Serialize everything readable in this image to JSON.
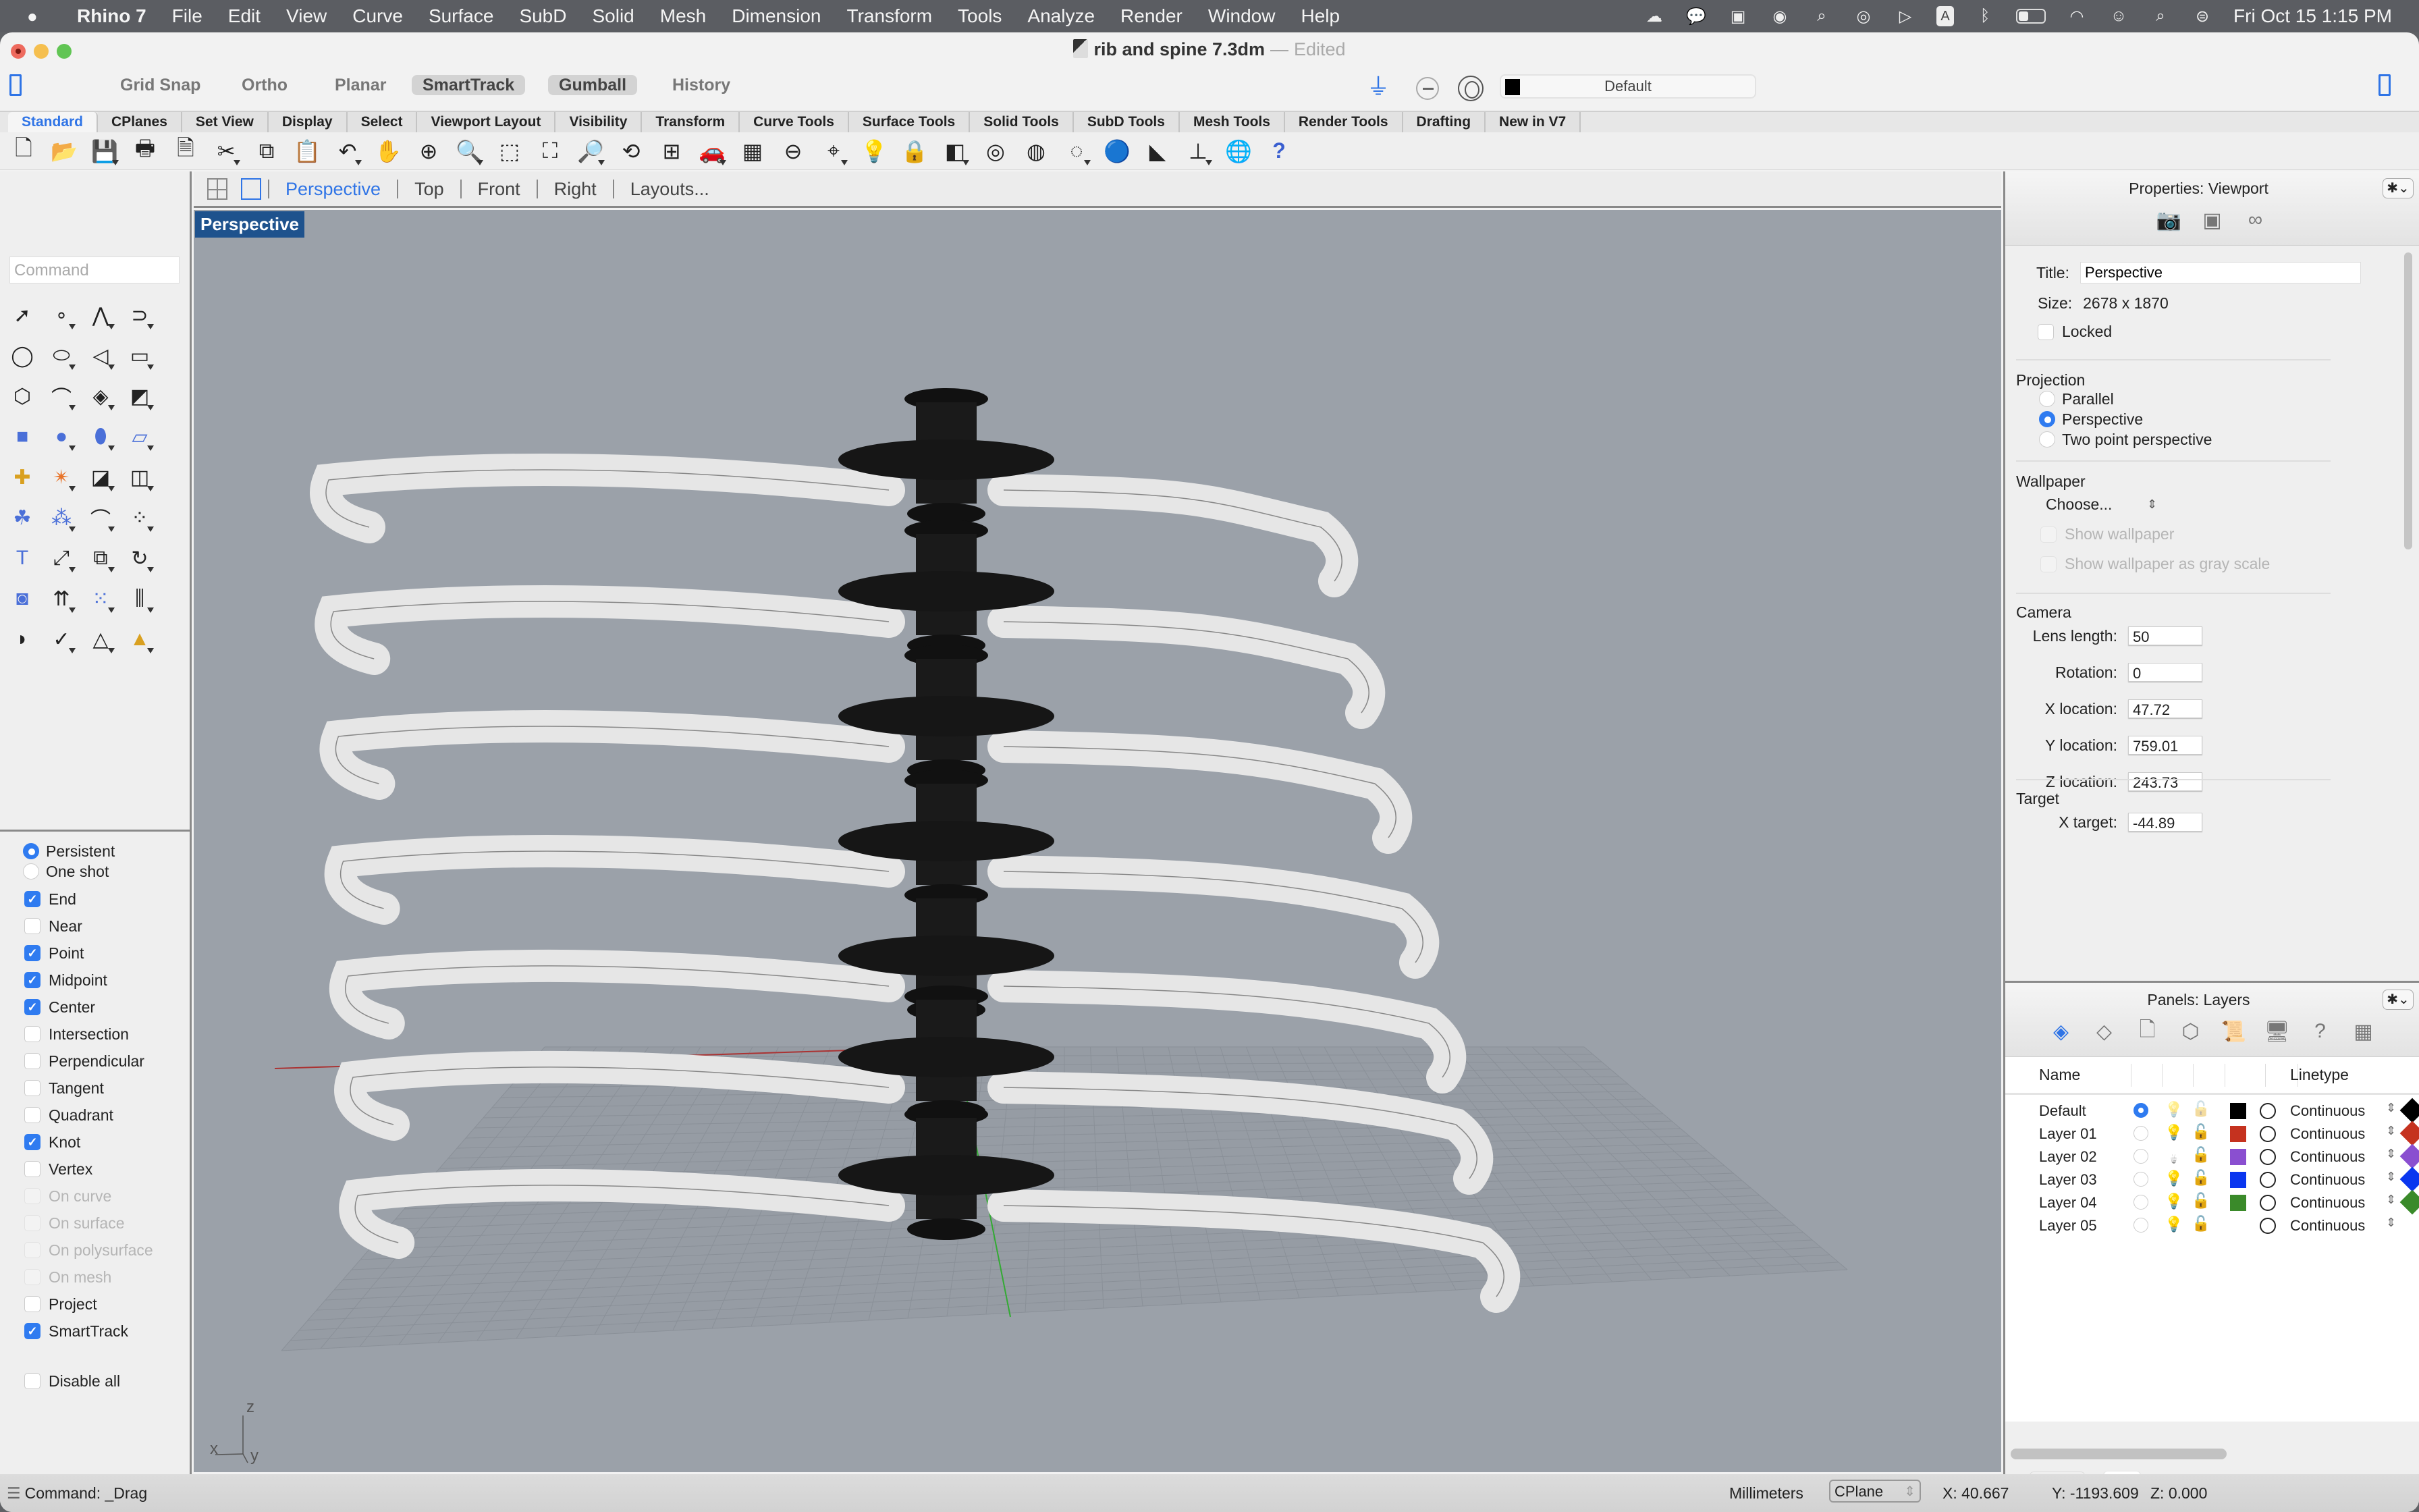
{
  "menubar": {
    "app_name": "Rhino 7",
    "items": [
      "File",
      "Edit",
      "View",
      "Curve",
      "Surface",
      "SubD",
      "Solid",
      "Mesh",
      "Dimension",
      "Transform",
      "Tools",
      "Analyze",
      "Render",
      "Window",
      "Help"
    ],
    "status_icons": [
      "creative-cloud-icon",
      "wechat-icon",
      "zoom-icon",
      "browser-icon",
      "screenshot-icon",
      "disc-icon",
      "play-icon",
      "input-source-icon",
      "bluetooth-icon",
      "battery-icon",
      "wifi-icon",
      "user-icon",
      "spotlight-icon",
      "control-center-icon"
    ],
    "input_source": "A",
    "clock": "Fri Oct 15  1:15 PM"
  },
  "window": {
    "document_name": "rib and spine 7.3dm",
    "separator": "—",
    "state": "Edited"
  },
  "toggles": [
    {
      "label": "Grid Snap",
      "on": false
    },
    {
      "label": "Ortho",
      "on": false
    },
    {
      "label": "Planar",
      "on": false
    },
    {
      "label": "SmartTrack",
      "on": true
    },
    {
      "label": "Gumball",
      "on": true
    },
    {
      "label": "History",
      "on": false
    }
  ],
  "current_layer": {
    "name": "Default",
    "color": "#000000"
  },
  "toolbar_tabs": [
    "Standard",
    "CPlanes",
    "Set View",
    "Display",
    "Select",
    "Viewport Layout",
    "Visibility",
    "Transform",
    "Curve Tools",
    "Surface Tools",
    "Solid Tools",
    "SubD Tools",
    "Mesh Tools",
    "Render Tools",
    "Drafting",
    "New in V7"
  ],
  "active_toolbar_tab": "Standard",
  "standard_tools": [
    {
      "name": "new-file-icon",
      "glyph": "🗋"
    },
    {
      "name": "open-folder-icon",
      "glyph": "📂"
    },
    {
      "name": "save-icon",
      "glyph": "💾"
    },
    {
      "name": "print-icon",
      "glyph": "🖶"
    },
    {
      "name": "properties-icon",
      "glyph": "🗎"
    },
    {
      "name": "cut-icon",
      "glyph": "✂"
    },
    {
      "name": "copy-icon",
      "glyph": "⧉"
    },
    {
      "name": "paste-icon",
      "glyph": "📋"
    },
    {
      "name": "undo-icon",
      "glyph": "↶"
    },
    {
      "name": "pan-hand-icon",
      "glyph": "✋"
    },
    {
      "name": "rotate-view-icon",
      "glyph": "⊕"
    },
    {
      "name": "zoom-in-out-icon",
      "glyph": "🔍"
    },
    {
      "name": "zoom-window-icon",
      "glyph": "⬚"
    },
    {
      "name": "zoom-extents-icon",
      "glyph": "⛶"
    },
    {
      "name": "zoom-selected-icon",
      "glyph": "🔎"
    },
    {
      "name": "undo-view-icon",
      "glyph": "⟲"
    },
    {
      "name": "viewport-layout-icon",
      "glyph": "⊞"
    },
    {
      "name": "car-icon",
      "glyph": "🚗"
    },
    {
      "name": "cplane-icon",
      "glyph": "▦"
    },
    {
      "name": "gumball-icon",
      "glyph": "⊖"
    },
    {
      "name": "osnap-icon",
      "glyph": "⌖"
    },
    {
      "name": "light-bulb-icon",
      "glyph": "💡"
    },
    {
      "name": "lock-icon",
      "glyph": "🔒"
    },
    {
      "name": "layer-icon",
      "glyph": "◧"
    },
    {
      "name": "color-wheel-icon",
      "glyph": "◎"
    },
    {
      "name": "wireframe-icon",
      "glyph": "◍"
    },
    {
      "name": "shaded-grid-icon",
      "glyph": "◌"
    },
    {
      "name": "rendered-icon",
      "glyph": "🔵"
    },
    {
      "name": "render-icon",
      "glyph": "◣"
    },
    {
      "name": "dimension-icon",
      "glyph": "⊥"
    },
    {
      "name": "food4rhino-icon",
      "glyph": "🌐"
    },
    {
      "name": "help-icon",
      "glyph": "?"
    }
  ],
  "viewport_tabs": [
    "Perspective",
    "Top",
    "Front",
    "Right",
    "Layouts..."
  ],
  "active_viewport_tab": "Perspective",
  "command": {
    "placeholder": "Command",
    "history": "Command: _Drag"
  },
  "sidebar_tools": [
    "select-arrow-icon",
    "point-icon",
    "polyline-icon",
    "curve-icon",
    "circle-icon",
    "ellipse-icon",
    "arc-icon",
    "rectangle-icon",
    "polygon-icon",
    "fillet-curve-icon",
    "surface-corner-points-icon",
    "extrude-surface-icon",
    "box-icon",
    "sphere-icon",
    "cylinder-icon",
    "mesh-plane-icon",
    "join-icon",
    "explode-icon",
    "trim-icon",
    "split-icon",
    "group-icon",
    "ungroup-icon",
    "fillet-icon",
    "offset-curve-icon",
    "text-icon",
    "move-icon",
    "copy-objects-icon",
    "rotate-icon",
    "boolean-icon",
    "project-icon",
    "array-icon",
    "mirror-icon",
    "bend-icon",
    "check-icon",
    "solid-primitives-icon",
    "pyramid-icon"
  ],
  "sidebar_glyphs": [
    "➚",
    "∘",
    "⋀",
    "⊃",
    "◯",
    "⬭",
    "◁",
    "▭",
    "⬡",
    "⌒",
    "◈",
    "◩",
    "■",
    "●",
    "⬮",
    "▱",
    "✚",
    "✴",
    "◪",
    "◫",
    "☘",
    "⁂",
    "⌒",
    "⁘",
    "T",
    "⤢",
    "⧉",
    "↻",
    "◙",
    "⇈",
    "⁙",
    "⫼",
    "◗",
    "✓",
    "△",
    "▲"
  ],
  "osnap": {
    "mode": [
      {
        "label": "Persistent",
        "selected": true
      },
      {
        "label": "One shot",
        "selected": false
      }
    ],
    "items": [
      {
        "label": "End",
        "checked": true,
        "enabled": true
      },
      {
        "label": "Near",
        "checked": false,
        "enabled": true
      },
      {
        "label": "Point",
        "checked": true,
        "enabled": true
      },
      {
        "label": "Midpoint",
        "checked": true,
        "enabled": true
      },
      {
        "label": "Center",
        "checked": true,
        "enabled": true
      },
      {
        "label": "Intersection",
        "checked": false,
        "enabled": true
      },
      {
        "label": "Perpendicular",
        "checked": false,
        "enabled": true
      },
      {
        "label": "Tangent",
        "checked": false,
        "enabled": true
      },
      {
        "label": "Quadrant",
        "checked": false,
        "enabled": true
      },
      {
        "label": "Knot",
        "checked": true,
        "enabled": true
      },
      {
        "label": "Vertex",
        "checked": false,
        "enabled": true
      },
      {
        "label": "On curve",
        "checked": false,
        "enabled": false
      },
      {
        "label": "On surface",
        "checked": false,
        "enabled": false
      },
      {
        "label": "On polysurface",
        "checked": false,
        "enabled": false
      },
      {
        "label": "On mesh",
        "checked": false,
        "enabled": false
      },
      {
        "label": "Project",
        "checked": false,
        "enabled": true
      },
      {
        "label": "SmartTrack",
        "checked": true,
        "enabled": true
      }
    ],
    "disable_all": {
      "label": "Disable all",
      "checked": false
    }
  },
  "viewport": {
    "label": "Perspective",
    "axes": {
      "x": "x",
      "y": "y",
      "z": "z"
    }
  },
  "properties": {
    "panel_title": "Properties: Viewport",
    "tab_icons": [
      "camera-icon",
      "frame-icon",
      "link-icon"
    ],
    "title_label": "Title:",
    "title_value": "Perspective",
    "size_label": "Size:",
    "size_value": "2678 x 1870",
    "locked_label": "Locked",
    "locked": false,
    "projection_heading": "Projection",
    "projection_options": [
      {
        "label": "Parallel",
        "selected": false
      },
      {
        "label": "Perspective",
        "selected": true
      },
      {
        "label": "Two point perspective",
        "selected": false
      }
    ],
    "wallpaper_heading": "Wallpaper",
    "wallpaper_choose": "Choose...",
    "show_wallpaper": "Show wallpaper",
    "show_wallpaper_gray": "Show wallpaper as gray scale",
    "camera_heading": "Camera",
    "camera_fields": [
      {
        "label": "Lens length:",
        "value": "50"
      },
      {
        "label": "Rotation:",
        "value": "0"
      },
      {
        "label": "X location:",
        "value": "47.72"
      },
      {
        "label": "Y location:",
        "value": "759.01"
      },
      {
        "label": "Z location:",
        "value": "243.73"
      }
    ],
    "target_heading": "Target",
    "target_fields": [
      {
        "label": "X target:",
        "value": "-44.89"
      }
    ]
  },
  "layers": {
    "panel_title": "Panels: Layers",
    "tab_icons": [
      "layers-icon",
      "layer-states-icon",
      "document-icon",
      "block-icon",
      "notes-icon",
      "display-icon",
      "help-icon",
      "layout-icon"
    ],
    "columns": {
      "name": "Name",
      "linetype": "Linetype"
    },
    "rows": [
      {
        "name": "Default",
        "current": true,
        "visible": true,
        "bulb_dim": true,
        "locked": false,
        "color": "#000000",
        "linetype": "Continuous",
        "print_color": "#000000"
      },
      {
        "name": "Layer 01",
        "current": false,
        "visible": true,
        "bulb_dim": false,
        "locked": false,
        "color": "#c5321f",
        "linetype": "Continuous",
        "print_color": "#c5321f"
      },
      {
        "name": "Layer 02",
        "current": false,
        "visible": false,
        "bulb_dim": false,
        "locked": false,
        "color": "#8a4fd0",
        "linetype": "Continuous",
        "print_color": "#8a4fd0"
      },
      {
        "name": "Layer 03",
        "current": false,
        "visible": true,
        "bulb_dim": false,
        "locked": false,
        "color": "#0a36ef",
        "linetype": "Continuous",
        "print_color": "#0a36ef"
      },
      {
        "name": "Layer 04",
        "current": false,
        "visible": true,
        "bulb_dim": false,
        "locked": false,
        "color": "#3a8a2a",
        "linetype": "Continuous",
        "print_color": "#3a8a2a"
      },
      {
        "name": "Layer 05",
        "current": false,
        "visible": true,
        "bulb_dim": false,
        "locked": false,
        "color": "",
        "linetype": "Continuous",
        "print_color": ""
      }
    ],
    "add": "+",
    "remove": "—"
  },
  "statusbar": {
    "units": "Millimeters",
    "cplane": "CPlane",
    "x": "X: 40.667",
    "y": "Y: -1193.609",
    "z": "Z: 0.000"
  },
  "colors": {
    "accent": "#2f74e6",
    "viewport_bg": "#9ba1a9",
    "viewport_label_bg": "#1e528d"
  }
}
